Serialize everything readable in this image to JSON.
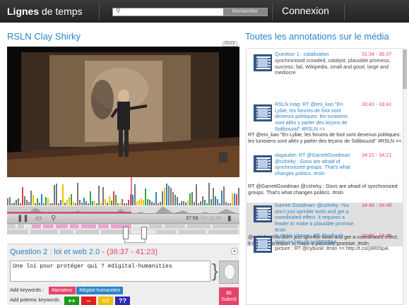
{
  "header": {
    "logo_bold": "Lignes",
    "logo_rest": " de temps",
    "search_placeholder": "",
    "search_button": "Rechercher",
    "login": "Connexion"
  },
  "media": {
    "title": "RSLN Clay Shirky",
    "block_tab": "Block",
    "time_current": "37:58",
    "time_total": "/ 01:11:40"
  },
  "annotation_form": {
    "title": "Question 2 : loi et web 2.0",
    "timecode": " - (36:37 - 41:23)",
    "text": "Une loi pour protéger qui ? #digital-humanities",
    "add_keywords_label": "Add keywords :",
    "keywords": [
      "#amateur",
      "#digital-humanities"
    ],
    "add_polemic_label": "Add polemic keywords",
    "polemic": [
      {
        "label": "++",
        "color": "#1a9a1a"
      },
      {
        "label": "--",
        "color": "#e02020"
      },
      {
        "label": "==",
        "color": "#f0c000"
      },
      {
        "label": "??",
        "color": "#2a2ab0"
      }
    ],
    "submit": "Submit"
  },
  "annotations_panel": {
    "title": "Toutes les annotations sur le média",
    "items": [
      {
        "title": "Question 1 : catalisation",
        "timecode": "31:34 - 36:37",
        "body": "synchronised crowded, catalyst, plausible promess, success, fail, Wikipedia, small and good, large and mediocre",
        "footer": ""
      },
      {
        "title": "RSLN mag: RT @eni_kao \"En Lybie, les forums de foot sont devenus politiques: les tunisiens sont allés y parler des leçons de Sidibouzid\" #RSLN ==",
        "timecode": "33:41 - 33:41",
        "body": "",
        "footer": "RT @eni_kao \"En Lybie, les forums de foot sont devenus politiques: les tunisiens sont allés y parler des leçons de Sidibouzid\" #RSLN =="
      },
      {
        "title": "dagautier: RT @GarrettGoodman @cshirky : Govs are afraid of synchronized groups. That's what changes politics. #rsln",
        "timecode": "34:21 - 34:21",
        "body": "",
        "footer": "RT @GarrettGoodman @cshirky : Govs are afraid of synchronized groups. That's what changes politics. #rsln"
      },
      {
        "title": "Garrett Goodman: @cshirky: You don't just sprinkle tools and get a coordinated effect. It requires a leader to make a plausible promise. #rsln",
        "timecode": "34:48 - 34:48",
        "body": "",
        "footer": "@cshirky: You don't just sprinkle tools and get a coordinated effect. It requires a leader to make a plausible promise. #rsln"
      },
      {
        "title": "la pinta: picture : RT @cybunk: #rsln == http://t.co/j3R0SpA",
        "timecode": "34:48 - 34:48",
        "body": "picture : RT @cybunk: #rsln == http://t.co/j3R0SpA",
        "footer": ""
      }
    ]
  },
  "colors": {
    "accent_blue": "#2a84c6",
    "accent_pink": "#e5446a",
    "header_bg": "#2a2a2a"
  }
}
